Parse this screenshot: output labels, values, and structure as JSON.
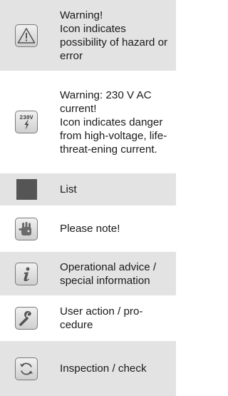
{
  "legend": {
    "items": [
      {
        "icon": "warning-triangle-icon",
        "text": "Warning!\nIcon indicates possibility of hazard or error"
      },
      {
        "icon": "high-voltage-230v-icon",
        "icon_label": "230V",
        "text": "Warning: 230 V AC current!\nIcon indicates danger from high-voltage, life-threat-ening current."
      },
      {
        "icon": "list-square-icon",
        "text": "List"
      },
      {
        "icon": "hand-note-icon",
        "text": "Please note!"
      },
      {
        "icon": "info-i-icon",
        "text": "Operational advice / special information"
      },
      {
        "icon": "wrench-icon",
        "text": "User action / pro-cedure"
      },
      {
        "icon": "refresh-cycle-icon",
        "text": "Inspection / check"
      }
    ]
  },
  "colors": {
    "shaded_row": "#e3e3e3",
    "icon_border": "#7a7a7a",
    "square": "#555555"
  }
}
